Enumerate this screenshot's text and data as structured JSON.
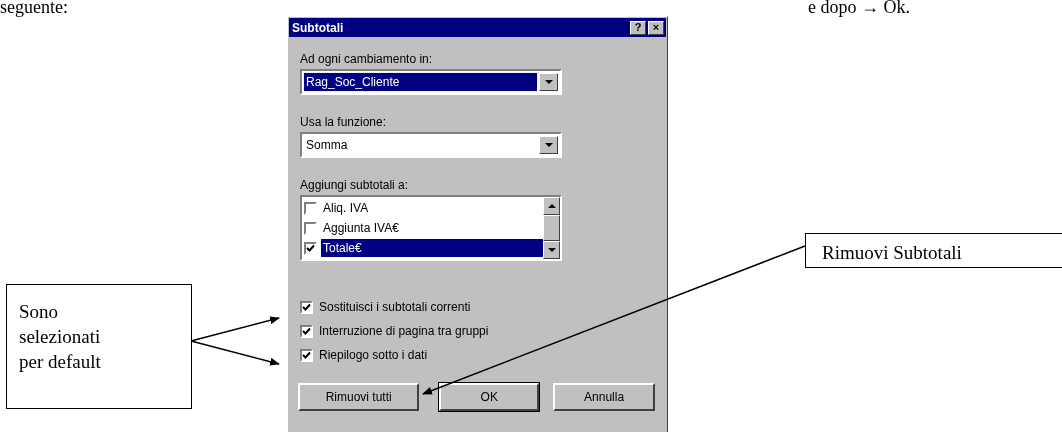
{
  "page_text": {
    "left": "seguente:",
    "right": "e dopo → Ok."
  },
  "dialog": {
    "title": "Subtotali",
    "title_buttons": [
      "?",
      "×"
    ],
    "fields": [
      {
        "label": "Ad ogni cambiamento in:",
        "value": "Rag_Soc_Cliente",
        "focused": true
      },
      {
        "label": "Usa la funzione:",
        "value": "Somma",
        "focused": false
      }
    ],
    "list": {
      "label": "Aggiungi subtotali a:",
      "items": [
        {
          "text": "Aliq. IVA",
          "checked": false,
          "selected": false
        },
        {
          "text": "Aggiunta IVA€",
          "checked": false,
          "selected": false
        },
        {
          "text": "Totale€",
          "checked": true,
          "selected": true
        }
      ]
    },
    "options": [
      {
        "label": "Sostituisci i subtotali correnti",
        "checked": true
      },
      {
        "label": "Interruzione di pagina tra gruppi",
        "checked": true
      },
      {
        "label": "Riepilogo sotto i dati",
        "checked": true
      }
    ],
    "buttons": [
      {
        "label": "Rimuovi tutti",
        "default": false
      },
      {
        "label": "OK",
        "default": true
      },
      {
        "label": "Annulla",
        "default": false
      }
    ]
  },
  "callouts": [
    {
      "text": "Sono selezionati per default"
    },
    {
      "text": "Rimuovi Subtotali"
    }
  ]
}
